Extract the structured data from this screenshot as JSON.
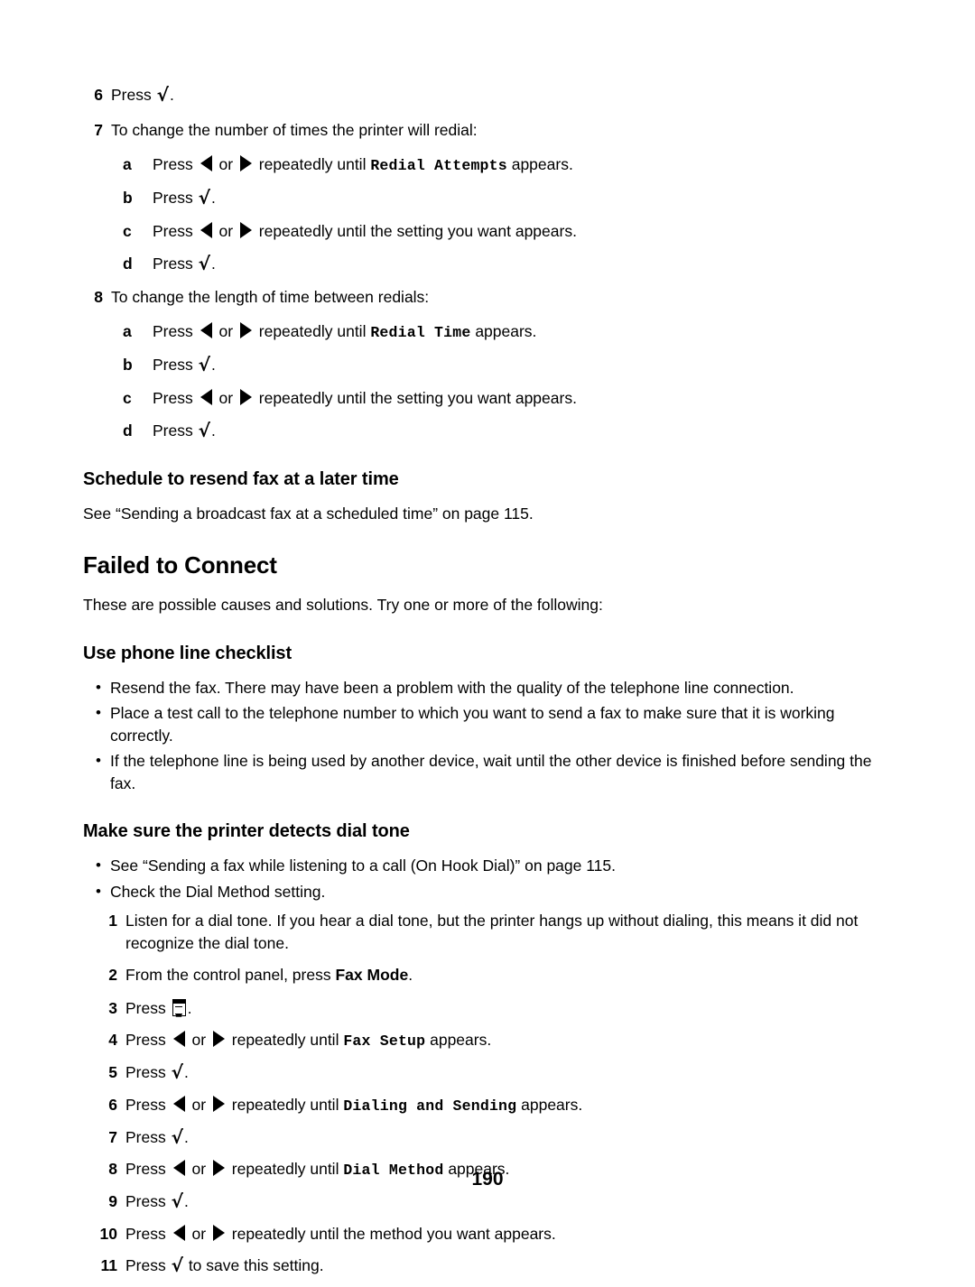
{
  "page": {
    "number": "190"
  },
  "icons": {
    "check": "√",
    "left_arrow": "left-arrow",
    "right_arrow": "right-arrow",
    "menu": "menu"
  },
  "steps_top": [
    {
      "marker": "6",
      "text_before": "Press ",
      "icon": "check",
      "text_after": "."
    },
    {
      "marker": "7",
      "text_before": "To change the number of times the printer will redial:",
      "substeps": [
        {
          "marker": "a",
          "lead": "Press ",
          "mid": " or ",
          "tail": " repeatedly until ",
          "code": "Redial Attempts",
          "end": " appears."
        },
        {
          "marker": "b",
          "lead": "Press ",
          "end": "."
        },
        {
          "marker": "c",
          "lead": "Press ",
          "mid": " or ",
          "tail": " repeatedly until the setting you want appears."
        },
        {
          "marker": "d",
          "lead": "Press ",
          "end": "."
        }
      ]
    },
    {
      "marker": "8",
      "text_before": "To change the length of time between redials:",
      "substeps": [
        {
          "marker": "a",
          "lead": "Press ",
          "mid": " or ",
          "tail": " repeatedly until ",
          "code": "Redial Time",
          "end": " appears."
        },
        {
          "marker": "b",
          "lead": "Press ",
          "end": "."
        },
        {
          "marker": "c",
          "lead": "Press ",
          "mid": " or ",
          "tail": " repeatedly until the setting you want appears."
        },
        {
          "marker": "d",
          "lead": "Press ",
          "end": "."
        }
      ]
    }
  ],
  "schedule_section": {
    "heading": "Schedule to resend fax at a later time",
    "paragraph": "See “Sending a broadcast fax at a scheduled time” on page 115."
  },
  "failed_section": {
    "heading": "Failed to Connect",
    "intro": "These are possible causes and solutions. Try one or more of the following:",
    "checklist": {
      "heading": "Use phone line checklist",
      "items": [
        "Resend the fax. There may have been a problem with the quality of the telephone line connection.",
        "Place a test call to the telephone number to which you want to send a fax to make sure that it is working correctly.",
        "If the telephone line is being used by another device, wait until the other device is finished before sending the fax."
      ]
    },
    "dialtone": {
      "heading": "Make sure the printer detects dial tone",
      "bullets": [
        "See “Sending a fax while listening to a call (On Hook Dial)” on page 115.",
        "Check the Dial Method setting."
      ],
      "steps": [
        {
          "marker": "1",
          "type": "plain",
          "text": "Listen for a dial tone. If you hear a dial tone, but the printer hangs up without dialing, this means it did not recognize the dial tone."
        },
        {
          "marker": "2",
          "type": "bold-inline",
          "lead": "From the control panel, press ",
          "bold": "Fax Mode",
          "end": "."
        },
        {
          "marker": "3",
          "type": "press-menu",
          "lead": "Press ",
          "end": "."
        },
        {
          "marker": "4",
          "type": "press-arrows-code",
          "lead": "Press ",
          "mid": " or ",
          "tail": " repeatedly until ",
          "code": "Fax Setup",
          "end": " appears."
        },
        {
          "marker": "5",
          "type": "press-check",
          "lead": "Press ",
          "end": "."
        },
        {
          "marker": "6",
          "type": "press-arrows-code",
          "lead": "Press ",
          "mid": " or ",
          "tail": " repeatedly until ",
          "code": "Dialing and Sending",
          "end": " appears."
        },
        {
          "marker": "7",
          "type": "press-check",
          "lead": "Press ",
          "end": "."
        },
        {
          "marker": "8",
          "type": "press-arrows-code",
          "lead": "Press ",
          "mid": " or ",
          "tail": " repeatedly until ",
          "code": "Dial Method",
          "end": " appears."
        },
        {
          "marker": "9",
          "type": "press-check",
          "lead": "Press ",
          "end": "."
        },
        {
          "marker": "10",
          "type": "press-arrows-plain",
          "lead": "Press ",
          "mid": " or ",
          "tail": " repeatedly until the method you want appears."
        },
        {
          "marker": "11",
          "type": "press-check",
          "lead": "Press ",
          "end": " to save this setting."
        }
      ]
    }
  }
}
